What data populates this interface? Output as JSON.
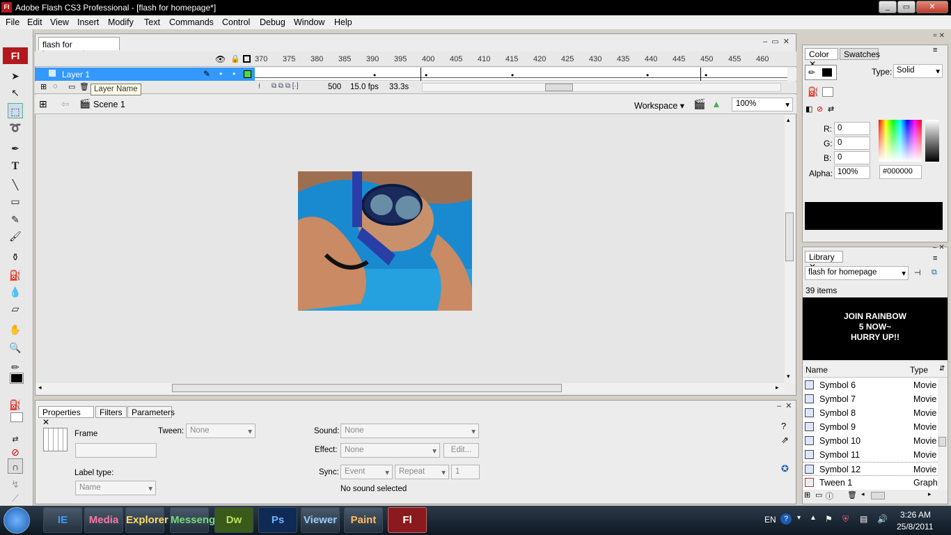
{
  "window": {
    "app_icon": "Fl",
    "title": "Adobe Flash CS3 Professional - [flash for homepage*]",
    "min": "_",
    "max": "▭",
    "close": "✕"
  },
  "menu": [
    "File",
    "Edit",
    "View",
    "Insert",
    "Modify",
    "Text",
    "Commands",
    "Control",
    "Debug",
    "Window",
    "Help"
  ],
  "toolbar": {
    "logo": "Fl"
  },
  "document": {
    "tab": "flash for homepage*",
    "tab_close": "✕"
  },
  "timeline": {
    "ruler": [
      "370",
      "375",
      "380",
      "385",
      "390",
      "395",
      "400",
      "405",
      "410",
      "415",
      "420",
      "425",
      "430",
      "435",
      "440",
      "445",
      "450",
      "455",
      "460"
    ],
    "layer_name": "Layer 1",
    "tooltip": "Layer Name",
    "frame": "500",
    "fps": "15.0 fps",
    "time": "33.3s"
  },
  "editbar": {
    "scene": "Scene 1",
    "workspace": "Workspace",
    "zoom": "100%"
  },
  "properties": {
    "tabs": [
      "Properties",
      "Filters",
      "Parameters"
    ],
    "frame_label": "Frame",
    "tween_label": "Tween:",
    "tween_value": "None",
    "sound_label": "Sound:",
    "sound_value": "None",
    "effect_label": "Effect:",
    "effect_value": "None",
    "edit_btn": "Edit...",
    "label_type": "Label type:",
    "label_type_value": "Name",
    "sync_label": "Sync:",
    "sync_event": "Event",
    "sync_repeat": "Repeat",
    "sync_count": "1",
    "no_sound": "No sound selected"
  },
  "color": {
    "tabs": [
      "Color",
      "Swatches"
    ],
    "type_label": "Type:",
    "type_value": "Solid",
    "r_label": "R:",
    "r": "0",
    "g_label": "G:",
    "g": "0",
    "b_label": "B:",
    "b": "0",
    "alpha_label": "Alpha:",
    "alpha": "100%",
    "hex": "#000000",
    "swatch_color": "#000000"
  },
  "library": {
    "tab": "Library",
    "doc": "flash for homepage",
    "count": "39 items",
    "preview": [
      "JOIN RAINBOW",
      "5 NOW~",
      "HURRY UP!!"
    ],
    "col_name": "Name",
    "col_type": "Type",
    "items": [
      {
        "name": "Symbol 6",
        "type": "Movie"
      },
      {
        "name": "Symbol 7",
        "type": "Movie"
      },
      {
        "name": "Symbol 8",
        "type": "Movie"
      },
      {
        "name": "Symbol 9",
        "type": "Movie"
      },
      {
        "name": "Symbol 10",
        "type": "Movie"
      },
      {
        "name": "Symbol 11",
        "type": "Movie"
      },
      {
        "name": "Symbol 12",
        "type": "Movie"
      },
      {
        "name": "Tween 1",
        "type": "Graph"
      }
    ]
  },
  "taskbar": {
    "apps": [
      "IE",
      "Media",
      "Explorer",
      "Messenger",
      "Dw",
      "Ps",
      "Viewer",
      "Paint",
      "Fl"
    ],
    "lang": "EN",
    "time": "3:26 AM",
    "date": "25/8/2011"
  }
}
